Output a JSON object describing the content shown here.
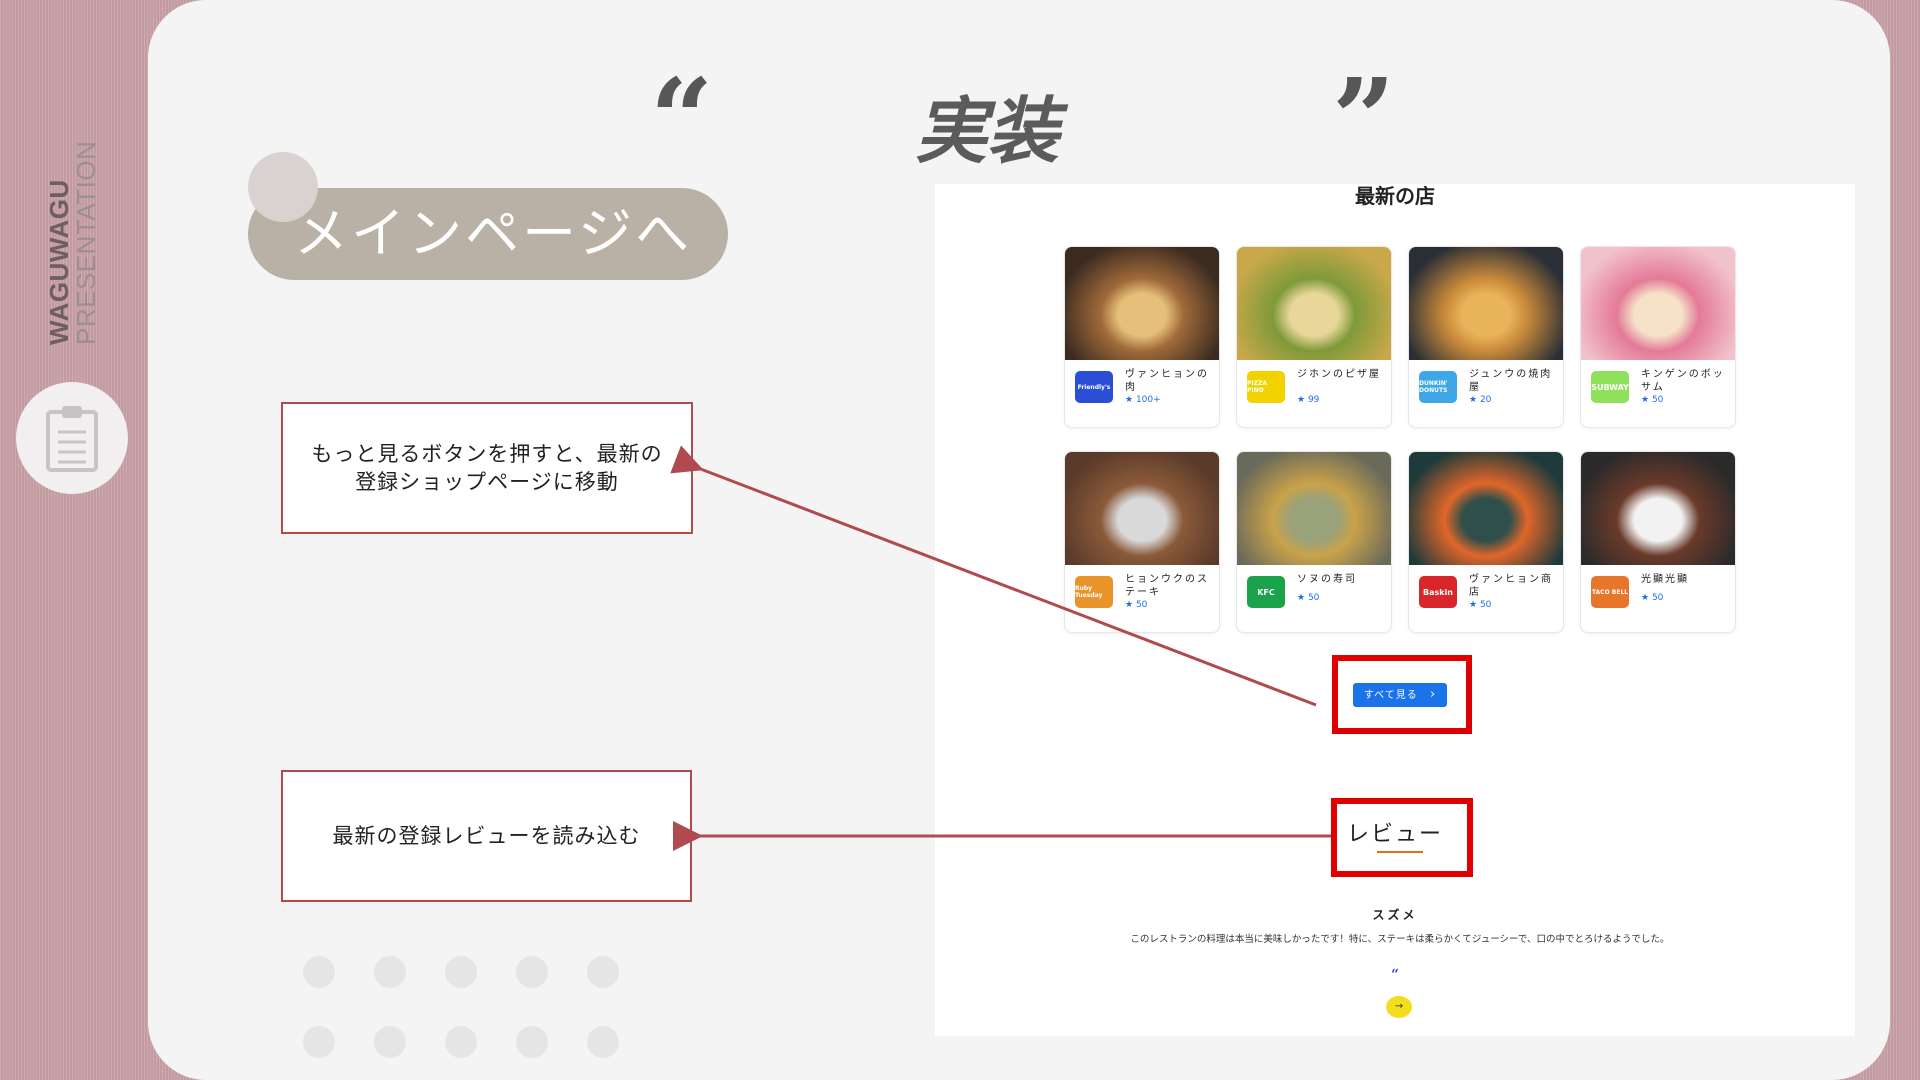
{
  "brand": {
    "line1": "WAGUWAGU",
    "line2": "PRESENTATION"
  },
  "slide": {
    "title": "実装",
    "open_quote": "“",
    "close_quote": "”"
  },
  "main_button": {
    "label": "メインページへ"
  },
  "notes": {
    "more_button": "もっと見るボタンを押すと、最新の\n登録ショップページに移動",
    "reviews": "最新の登録レビューを読み込む"
  },
  "screenshot": {
    "section_title": "最新の店",
    "shops": [
      {
        "name": "ヴァンヒョンの肉",
        "rating": "100+",
        "logo": "Friendly's",
        "logo_color": "#2a4fd6",
        "photo_colors": [
          "#3a2a20",
          "#a06a3a",
          "#e6c07a"
        ]
      },
      {
        "name": "ジホンのピザ屋",
        "rating": "99",
        "logo": "PIZZA PINO",
        "logo_color": "#f2d200",
        "photo_colors": [
          "#c9a84a",
          "#7f9a3a",
          "#e9d79a"
        ]
      },
      {
        "name": "ジュンウの焼肉屋",
        "rating": "20",
        "logo": "DUNKIN' DONUTS",
        "logo_color": "#3fa6e8",
        "photo_colors": [
          "#2a2f36",
          "#c98a3a",
          "#e9b35a"
        ]
      },
      {
        "name": "キンゲンのボッサム",
        "rating": "50",
        "logo": "SUBWAY",
        "logo_color": "#8fe05a",
        "photo_colors": [
          "#f2c2cc",
          "#e47a98",
          "#f6e2c8"
        ]
      },
      {
        "name": "ヒョンウクのステーキ",
        "rating": "50",
        "logo": "Ruby Tuesday",
        "logo_color": "#e8942a",
        "photo_colors": [
          "#5a3a2a",
          "#8a5a3a",
          "#d9d9d9"
        ]
      },
      {
        "name": "ソヌの寿司",
        "rating": "50",
        "logo": "KFC",
        "logo_color": "#1aa34a",
        "photo_colors": [
          "#6a6a5a",
          "#c9a24a",
          "#9aa27a"
        ]
      },
      {
        "name": "ヴァンヒョン商店",
        "rating": "50",
        "logo": "Baskin",
        "logo_color": "#d9262a",
        "photo_colors": [
          "#1e3a3a",
          "#e0662a",
          "#2f4f4a"
        ]
      },
      {
        "name": "光顯光顯",
        "rating": "50",
        "logo": "TACO BELL",
        "logo_color": "#e8762a",
        "photo_colors": [
          "#2a2a2a",
          "#6a3a2a",
          "#f2f2f2"
        ]
      }
    ],
    "see_all_label": "すべて見る",
    "see_all_chevron": "›",
    "review_title": "レビュー",
    "reviewer": "スズメ",
    "review_text": "このレストランの料理は本当に美味しかったです！特に、ステーキは柔らかくてジューシーで、口の中でとろけるようでした。",
    "review_quote": "“",
    "next_arrow": "→"
  },
  "colors": {
    "highlight": "#e00000",
    "arrow": "#b04a4f",
    "primary": "#1a73e8"
  },
  "icons": {
    "clipboard": "clipboard-icon",
    "star": "star-icon"
  }
}
